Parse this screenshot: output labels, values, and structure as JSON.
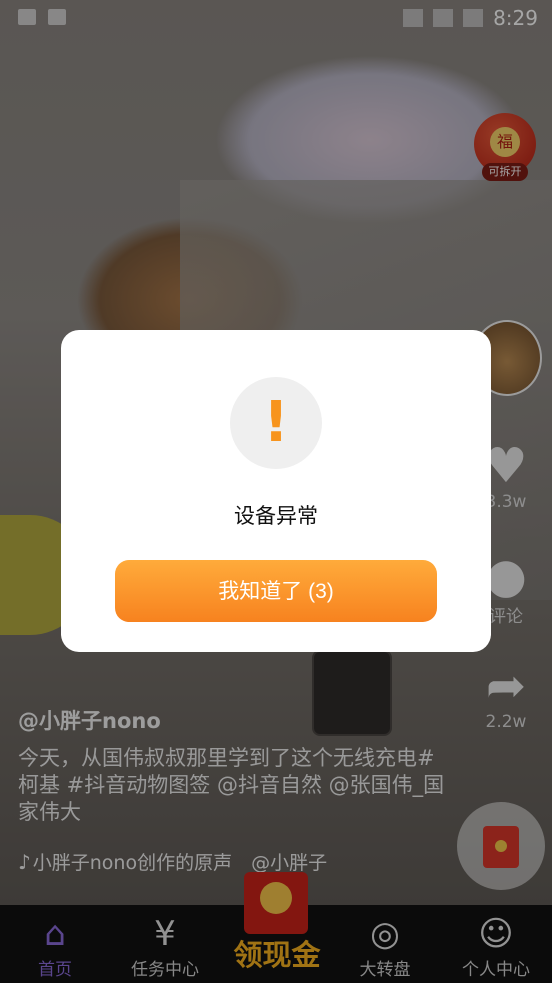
{
  "status_bar": {
    "time": "8:29"
  },
  "red_packet_badge": {
    "label": "可拆开",
    "glyph": "福"
  },
  "right_rail": {
    "like_count": "3.3w",
    "comment_label": "评论",
    "share_count": "2.2w"
  },
  "caption": {
    "author": "@小胖子nono",
    "description": "今天，从国伟叔叔那里学到了这个无线充电#柯基 #抖音动物图签 @抖音自然 @张国伟_国家伟大",
    "music": "小胖子nono创作的原声　@小胖子"
  },
  "tab_bar": {
    "items": [
      {
        "label": "首页",
        "icon": "home-icon"
      },
      {
        "label": "任务中心",
        "icon": "money-bag-icon"
      },
      {
        "label": "大转盘",
        "icon": "wheel-icon"
      },
      {
        "label": "个人中心",
        "icon": "person-icon"
      }
    ],
    "center_label": "领现金"
  },
  "dialog": {
    "title": "设备异常",
    "button_label": "我知道了 (3)",
    "icon": "!"
  },
  "colors": {
    "accent": "#f7941d",
    "active_tab": "#8a6bd9"
  }
}
